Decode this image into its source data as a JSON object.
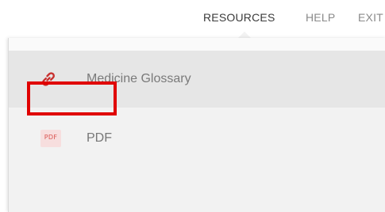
{
  "topnav": {
    "items": [
      {
        "label": "RESOURCES",
        "active": true
      },
      {
        "label": "HELP",
        "active": false
      },
      {
        "label": "EXIT",
        "active": false
      }
    ]
  },
  "dropdown": {
    "items": [
      {
        "label": "Medicine Glossary",
        "icon": "link-icon",
        "highlighted_row": true
      },
      {
        "label": "PDF",
        "icon": "pdf-file-icon",
        "icon_text": "PDF",
        "annotated": true
      }
    ]
  },
  "colors": {
    "link_icon": "#c8312f",
    "annotation_border": "#e00000",
    "panel_bg": "#f2f2f2",
    "hover_row_bg": "#e6e6e6"
  }
}
